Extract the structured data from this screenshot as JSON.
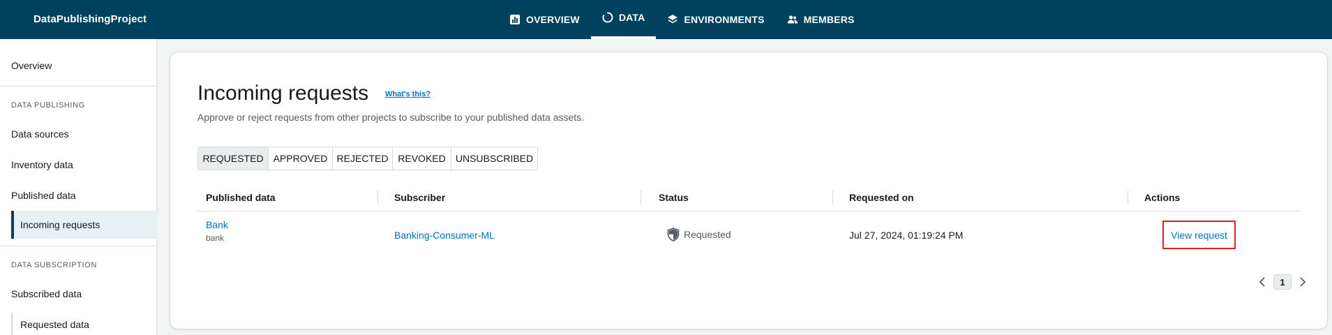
{
  "header": {
    "project_name": "DataPublishingProject",
    "nav": [
      {
        "label": "OVERVIEW",
        "icon": "bar-chart-icon"
      },
      {
        "label": "DATA",
        "icon": "loading-ring-icon"
      },
      {
        "label": "ENVIRONMENTS",
        "icon": "layers-icon"
      },
      {
        "label": "MEMBERS",
        "icon": "users-icon"
      }
    ],
    "active_nav": "DATA"
  },
  "sidebar": {
    "overview": "Overview",
    "section_publishing": "DATA PUBLISHING",
    "data_sources": "Data sources",
    "inventory_data": "Inventory data",
    "published_data": "Published data",
    "incoming_requests": "Incoming requests",
    "section_subscription": "DATA SUBSCRIPTION",
    "subscribed_data": "Subscribed data",
    "requested_data": "Requested data"
  },
  "main": {
    "title": "Incoming requests",
    "info_link": "What's this?",
    "description": "Approve or reject requests from other projects to subscribe to your published data assets.",
    "filters": [
      "REQUESTED",
      "APPROVED",
      "REJECTED",
      "REVOKED",
      "UNSUBSCRIBED"
    ],
    "selected_filter": "REQUESTED",
    "table": {
      "columns": [
        "Published data",
        "Subscriber",
        "Status",
        "Requested on",
        "Actions"
      ],
      "rows": [
        {
          "published_data": "Bank",
          "published_data_sub": "bank",
          "subscriber": "Banking-Consumer-ML",
          "status": "Requested",
          "requested_on": "Jul 27, 2024, 01:19:24 PM",
          "action": "View request"
        }
      ]
    },
    "pagination": {
      "current_page": "1"
    }
  },
  "colors": {
    "header_bg": "#00415e",
    "link": "#0073bb",
    "highlight_border": "#e02020"
  }
}
